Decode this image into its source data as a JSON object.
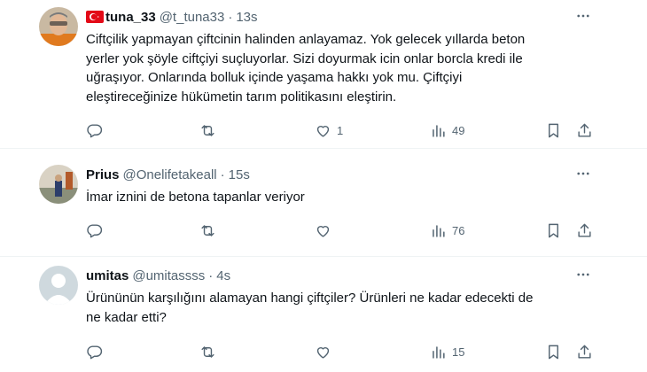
{
  "tweets": [
    {
      "name": "tuna_33",
      "handle": "@t_tuna33",
      "separator": "·",
      "time": "13s",
      "text": "Ciftçilik yapmayan çiftcinin halinden anlayamaz. Yok gelecek yıllarda beton\nyerler yok şöyle ciftçiyi suçluyorlar. Sizi doyurmak icin onlar borcla kredi ile\nuğraşıyor. Onlarında bolluk içinde yaşama hakkı yok mu. Çiftçiyi\neleştireceğinize hükümetin tarım politikasını eleştirin.",
      "likes": "1",
      "views": "49",
      "has_flag": true
    },
    {
      "name": "Prius",
      "handle": "@Onelifetakeall",
      "separator": "·",
      "time": "15s",
      "text": "İmar iznini de betona tapanlar veriyor",
      "likes": "",
      "views": "76",
      "has_flag": false
    },
    {
      "name": "umitas",
      "handle": "@umitassss",
      "separator": "·",
      "time": "4s",
      "text": "Ürününün karşılığını alamayan hangi çiftçiler? Ürünleri ne kadar edecekti de\nne kadar etti?",
      "likes": "",
      "views": "15",
      "has_flag": false
    }
  ],
  "icons": {
    "reply": "reply-icon",
    "retweet": "retweet-icon",
    "like": "heart-icon",
    "views": "views-icon",
    "bookmark": "bookmark-icon",
    "share": "share-icon",
    "more": "more-icon"
  },
  "colors": {
    "text": "#0f1419",
    "secondary": "#536471",
    "flag_red": "#e30a17",
    "divider": "#eff3f4"
  }
}
